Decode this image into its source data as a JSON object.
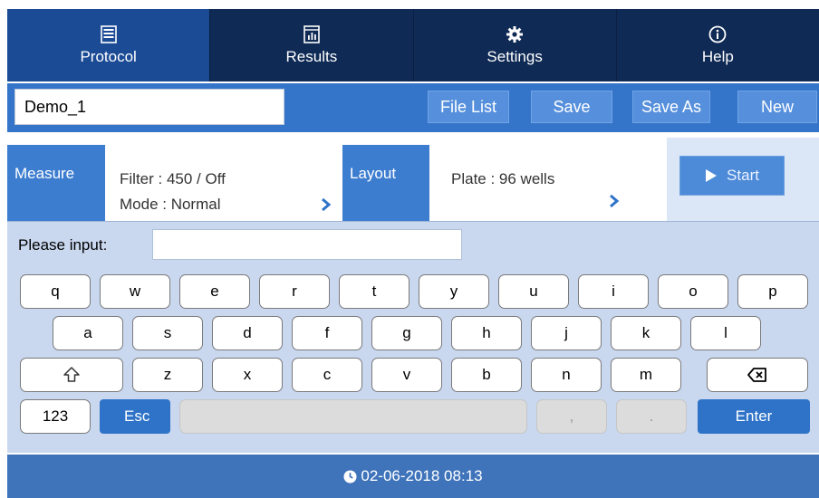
{
  "nav": {
    "tabs": [
      {
        "label": "Protocol",
        "icon": "protocol-icon",
        "active": true
      },
      {
        "label": "Results",
        "icon": "results-icon",
        "active": false
      },
      {
        "label": "Settings",
        "icon": "gear-icon",
        "active": false
      },
      {
        "label": "Help",
        "icon": "info-icon",
        "active": false
      }
    ]
  },
  "filebar": {
    "filename": "Demo_1",
    "file_list": "File List",
    "save": "Save",
    "save_as": "Save As",
    "new": "New"
  },
  "panel": {
    "measure_label": "Measure",
    "filter": "Filter : 450 / Off",
    "mode": "Mode : Normal",
    "layout_label": "Layout",
    "plate": "Plate :  96 wells",
    "start": "Start"
  },
  "keyboard": {
    "prompt": "Please input:",
    "input_value": "",
    "row1": [
      "q",
      "w",
      "e",
      "r",
      "t",
      "y",
      "u",
      "i",
      "o",
      "p"
    ],
    "row2": [
      "a",
      "s",
      "d",
      "f",
      "g",
      "h",
      "j",
      "k",
      "l"
    ],
    "row3": [
      "z",
      "x",
      "c",
      "v",
      "b",
      "n",
      "m"
    ],
    "num_key": "123",
    "esc_key": "Esc",
    "comma_key": ",",
    "period_key": ".",
    "enter_key": "Enter",
    "shift_icon": "shift-icon",
    "backspace_icon": "backspace-icon"
  },
  "status": {
    "datetime": "02-06-2018 08:13"
  },
  "colors": {
    "nav_bg": "#0f2a55",
    "nav_active": "#1b4b95",
    "accent": "#2e73c8",
    "keyboard_bg": "#c9d7ef"
  }
}
